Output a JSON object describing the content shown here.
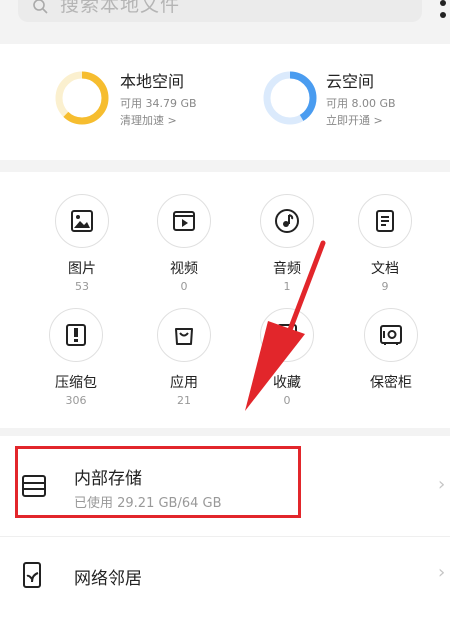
{
  "search": {
    "placeholder": "搜索本地文件"
  },
  "storage": {
    "local": {
      "title": "本地空间",
      "available": "可用 34.79 GB",
      "action": "清理加速 >"
    },
    "cloud": {
      "title": "云空间",
      "available": "可用 8.00 GB",
      "action": "立即开通 >"
    }
  },
  "categories": [
    {
      "label": "图片",
      "count": "53",
      "icon": "image-icon"
    },
    {
      "label": "视频",
      "count": "0",
      "icon": "video-icon"
    },
    {
      "label": "音频",
      "count": "1",
      "icon": "audio-icon"
    },
    {
      "label": "文档",
      "count": "9",
      "icon": "document-icon"
    },
    {
      "label": "压缩包",
      "count": "306",
      "icon": "archive-icon"
    },
    {
      "label": "应用",
      "count": "21",
      "icon": "app-bag-icon"
    },
    {
      "label": "收藏",
      "count": "0",
      "icon": "favorite-icon"
    },
    {
      "label": "保密柜",
      "count": "",
      "icon": "safe-icon"
    }
  ],
  "list": {
    "internal_storage": {
      "title": "内部存储",
      "usage": "已使用 29.21 GB/64 GB",
      "icon": "storage-icon"
    },
    "network_neighborhood": {
      "title": "网络邻居",
      "icon": "network-device-icon"
    }
  },
  "colors": {
    "local_ring": "#f6bd2f",
    "cloud_ring": "#4a9cf0",
    "highlight": "#e2262b"
  }
}
